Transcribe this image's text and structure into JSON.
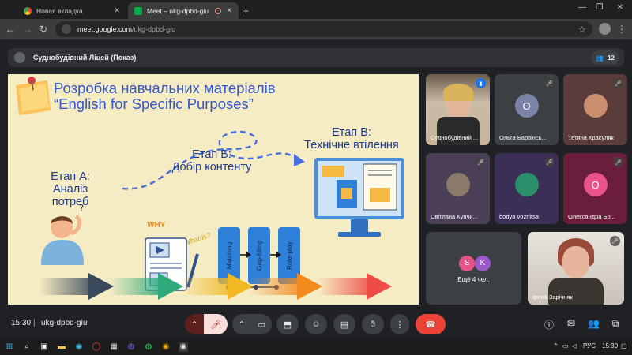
{
  "browser": {
    "tabs": [
      {
        "label": "Новая вкладка",
        "icon": "chrome-icon"
      },
      {
        "label": "Meet – ukg-dpbd-giu",
        "icon": "meet-icon",
        "active": true
      }
    ],
    "new_tab": "+",
    "url_host": "meet.google.com",
    "url_path": "/ukg-dpbd-giu"
  },
  "meet": {
    "presenter_bar": "Суднобудівний Ліцей (Показ)",
    "participants_count": "12",
    "meeting_code": "ukg-dpbd-giu",
    "time": "15:30",
    "separator": "|",
    "tiles": [
      {
        "name": "Суднобудівний ...",
        "type": "photo",
        "muted": false
      },
      {
        "name": "Ольга Барвінсь...",
        "type": "letter",
        "letter": "О",
        "color": "#7b82a8",
        "muted": true
      },
      {
        "name": "Тетяна Красуляк",
        "type": "photo-avatar",
        "muted": true
      },
      {
        "name": "Світлана Купчи...",
        "type": "photo-avatar",
        "muted": true
      },
      {
        "name": "bodya voznitsa",
        "type": "photo-avatar",
        "muted": true
      },
      {
        "name": "Олександра Бо...",
        "type": "letter",
        "letter": "О",
        "color": "#e8548a",
        "muted": true
      },
      {
        "name": "Ещё 4 чел.",
        "type": "more",
        "letters": [
          "S",
          "K"
        ]
      },
      {
        "name": "Ірина Зарічняк",
        "type": "photo",
        "muted": true
      }
    ]
  },
  "slide": {
    "title_line1": "Розробка навчальних матеріалів",
    "title_line2": "“English for Specific Purposes”",
    "stage_a_1": "Етап А:",
    "stage_a_2": "Аналіз потреб",
    "stage_b_1": "Етап Б:",
    "stage_b_2": "Добір контенту",
    "stage_c_1": "Етап В:",
    "stage_c_2": "Технічне втілення",
    "why": "WHY",
    "what_is": "What is?",
    "cards": [
      "Matching",
      "Gap-filling",
      "Role-play"
    ],
    "arrow_colors": [
      "#3a4a5c",
      "#2eaa7a",
      "#f2b824",
      "#f28a1e",
      "#ef4c45"
    ]
  },
  "taskbar": {
    "lang": "РУС",
    "clock": "15:30"
  }
}
